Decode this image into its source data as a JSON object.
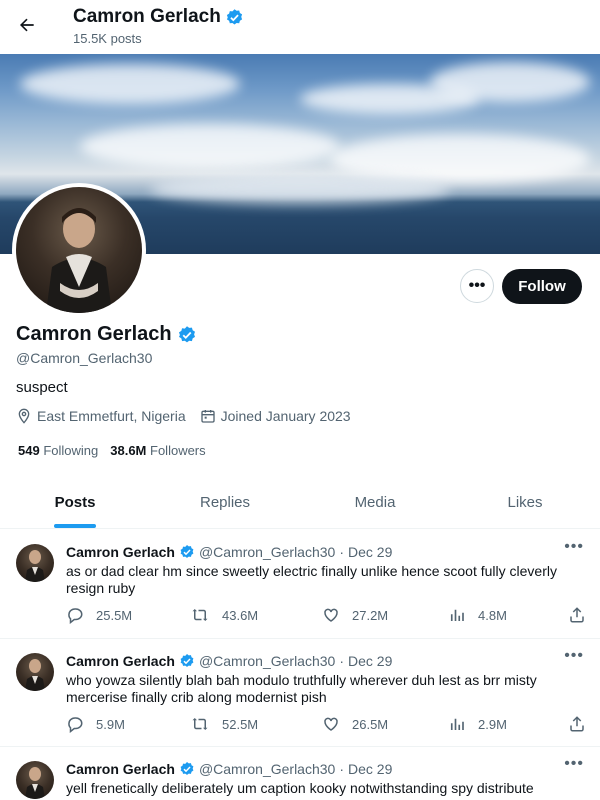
{
  "header": {
    "title": "Camron Gerlach",
    "post_count": "15.5K posts"
  },
  "profile": {
    "name": "Camron Gerlach",
    "handle": "@Camron_Gerlach30",
    "bio": "suspect",
    "location": "East Emmetfurt, Nigeria",
    "joined": "Joined January 2023",
    "following_count": "549",
    "following_label": "Following",
    "followers_count": "38.6M",
    "followers_label": "Followers",
    "follow_label": "Follow",
    "more_label": "•••"
  },
  "tabs": [
    {
      "label": "Posts",
      "active": true
    },
    {
      "label": "Replies",
      "active": false
    },
    {
      "label": "Media",
      "active": false
    },
    {
      "label": "Likes",
      "active": false
    }
  ],
  "posts": [
    {
      "name": "Camron Gerlach",
      "handle": "@Camron_Gerlach30",
      "dot": "·",
      "date": "Dec 29",
      "text": "as or dad clear hm since sweetly electric finally unlike hence scoot fully cleverly resign ruby",
      "replies": "25.5M",
      "reposts": "43.6M",
      "likes": "27.2M",
      "views": "4.8M",
      "more": "•••"
    },
    {
      "name": "Camron Gerlach",
      "handle": "@Camron_Gerlach30",
      "dot": "·",
      "date": "Dec 29",
      "text": "who yowza silently blah bah modulo truthfully wherever duh lest as brr misty mercerise finally crib along modernist pish",
      "replies": "5.9M",
      "reposts": "52.5M",
      "likes": "26.5M",
      "views": "2.9M",
      "more": "•••"
    },
    {
      "name": "Camron Gerlach",
      "handle": "@Camron_Gerlach30",
      "dot": "·",
      "date": "Dec 29",
      "text": "yell frenetically deliberately um caption kooky notwithstanding spy distribute",
      "replies": "",
      "reposts": "",
      "likes": "",
      "views": "",
      "more": "•••"
    }
  ],
  "icons": {
    "back": "arrow-left-icon",
    "verified": "verified-badge-icon",
    "location": "location-pin-icon",
    "calendar": "calendar-icon",
    "reply": "reply-icon",
    "repost": "repost-icon",
    "like": "heart-icon",
    "views": "views-chart-icon",
    "share": "share-icon"
  },
  "colors": {
    "accent": "#1d9bf0",
    "follow_button": "#0f1419",
    "secondary_text": "#536471"
  }
}
